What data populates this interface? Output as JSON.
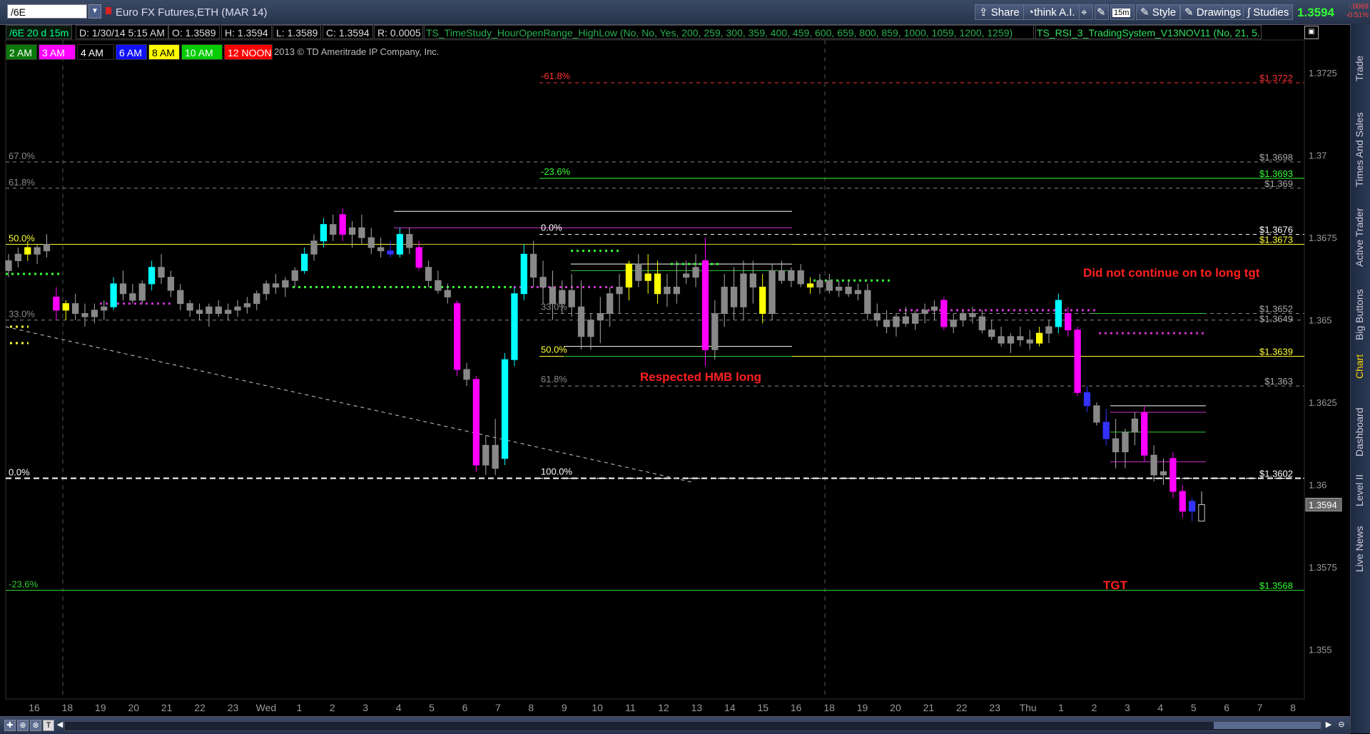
{
  "topbar": {
    "symbol": "/6E",
    "title": "Euro FX Futures,ETH (MAR 14)",
    "share": "Share",
    "think": "think A.I.",
    "interval": "15m",
    "style": "Style",
    "drawings": "Drawings",
    "studies": "Studies",
    "last_price": "1.3594",
    "change_abs": "-.0069",
    "change_pct": "-0.51%"
  },
  "inforow": {
    "period": "/6E 20 d 15m",
    "date": "D: 1/30/14 5:15 AM",
    "open": "O: 1.3589",
    "high": "H: 1.3594",
    "low": "L: 1.3589",
    "close": "C: 1.3594",
    "range": "R: 0.0005",
    "study1": "TS_TimeStudy_HourOpenRange_HighLow (No, No, Yes, 200, 259, 300, 359, 400, 459, 600, 659, 800, 859, 1000, 1059, 1200, 1259)",
    "study2": "TS_RSI_3_TradingSystem_V13NOV11 (No, 21, 5..."
  },
  "timeboxes": [
    {
      "label": "2 AM",
      "bg": "#0a7a0a",
      "fg": "#ffffff"
    },
    {
      "label": "3 AM",
      "bg": "#ff00ff",
      "fg": "#ffffff"
    },
    {
      "label": "4 AM",
      "bg": "#000000",
      "fg": "#ffffff"
    },
    {
      "label": "6 AM",
      "bg": "#1010ff",
      "fg": "#ffffff"
    },
    {
      "label": "8 AM",
      "bg": "#ffff00",
      "fg": "#000000"
    },
    {
      "label": "10 AM",
      "bg": "#00cc00",
      "fg": "#ffffff"
    },
    {
      "label": "12 NOON",
      "bg": "#ff0000",
      "fg": "#ffffff"
    }
  ],
  "copyright": "2013 © TD Ameritrade IP Company, Inc.",
  "sidebar": [
    "Trade",
    "Times And Sales",
    "Active Trader",
    "Big Buttons",
    "Chart",
    "Dashboard",
    "Level II",
    "Live News"
  ],
  "chart_data": {
    "type": "line",
    "ylim": [
      1.3535,
      1.3735
    ],
    "y_ticks": [
      "1.3725",
      "1.37",
      "1.3675",
      "1.365",
      "1.3625",
      "1.36",
      "1.3575",
      "1.355"
    ],
    "x_ticks": [
      "16",
      "18",
      "19",
      "20",
      "21",
      "22",
      "23",
      "Wed",
      "1",
      "2",
      "3",
      "4",
      "5",
      "6",
      "7",
      "8",
      "9",
      "10",
      "11",
      "12",
      "13",
      "14",
      "15",
      "16",
      "18",
      "19",
      "20",
      "21",
      "22",
      "23",
      "Thu",
      "1",
      "2",
      "3",
      "4",
      "5",
      "6",
      "7",
      "8"
    ],
    "last_price_tag": "1.3594",
    "fib_left": [
      {
        "label": "67.0%",
        "price": 1.3698
      },
      {
        "label": "61.8%",
        "price": 1.369
      },
      {
        "label": "50.0%",
        "price": 1.3673
      },
      {
        "label": "33.0%",
        "price": 1.365
      },
      {
        "label": "0.0%",
        "price": 1.3602
      },
      {
        "label": "-23.6%",
        "price": 1.3568
      }
    ],
    "fib_mid": [
      {
        "label": "-61.8%",
        "price": 1.3722
      },
      {
        "label": "-23.6%",
        "price": 1.3693
      },
      {
        "label": "0.0%",
        "price": 1.3676
      },
      {
        "label": "33.0%",
        "price": 1.3652
      },
      {
        "label": "50.0%",
        "price": 1.3639
      },
      {
        "label": "61.8%",
        "price": 1.363
      },
      {
        "label": "100.0%",
        "price": 1.3602
      }
    ],
    "price_labels": [
      {
        "text": "$1.3722",
        "price": 1.3722,
        "color": "#ff3333"
      },
      {
        "text": "$1.3698",
        "price": 1.3698,
        "color": "#aaaaaa"
      },
      {
        "text": "$1.3693",
        "price": 1.3693,
        "color": "#33ff33"
      },
      {
        "text": "$1.369",
        "price": 1.369,
        "color": "#aaaaaa"
      },
      {
        "text": "$1.3676",
        "price": 1.3676,
        "color": "#ffffff"
      },
      {
        "text": "$1.3673",
        "price": 1.3673,
        "color": "#ffff33"
      },
      {
        "text": "$1.3652",
        "price": 1.3652,
        "color": "#aaaaaa"
      },
      {
        "text": "$1.3649",
        "price": 1.3649,
        "color": "#aaaaaa"
      },
      {
        "text": "$1.3639",
        "price": 1.3639,
        "color": "#ffff33"
      },
      {
        "text": "$1.363",
        "price": 1.363,
        "color": "#aaaaaa"
      },
      {
        "text": "$1.3602",
        "price": 1.3602,
        "color": "#ffffff"
      },
      {
        "text": "$1.3568",
        "price": 1.3568,
        "color": "#33ff33"
      }
    ],
    "annotations": [
      {
        "text": "Respected HMB long",
        "color": "#ff2020"
      },
      {
        "text": "Did not continue on to long tgt",
        "color": "#ff2020"
      },
      {
        "text": "TGT",
        "color": "#ff2020"
      }
    ],
    "candles": [
      [
        1.3668,
        1.367,
        1.3663,
        1.3665,
        "#888888"
      ],
      [
        1.367,
        1.3672,
        1.3666,
        1.3668,
        "#888888"
      ],
      [
        1.3672,
        1.3674,
        1.3668,
        1.367,
        "#ffff00"
      ],
      [
        1.367,
        1.3673,
        1.3667,
        1.3672,
        "#888888"
      ],
      [
        1.3673,
        1.3676,
        1.3669,
        1.3671,
        "#888888"
      ],
      [
        1.3657,
        1.366,
        1.365,
        1.3653,
        "#ff00ff"
      ],
      [
        1.3653,
        1.3656,
        1.365,
        1.3655,
        "#ffff00"
      ],
      [
        1.3655,
        1.3658,
        1.365,
        1.3652,
        "#888888"
      ],
      [
        1.3652,
        1.3655,
        1.3648,
        1.3651,
        "#888888"
      ],
      [
        1.3651,
        1.3655,
        1.3649,
        1.3653,
        "#888888"
      ],
      [
        1.3653,
        1.3656,
        1.365,
        1.3654,
        "#888888"
      ],
      [
        1.3654,
        1.3663,
        1.3653,
        1.3661,
        "#00ffff"
      ],
      [
        1.3661,
        1.3665,
        1.3656,
        1.3658,
        "#888888"
      ],
      [
        1.3658,
        1.3661,
        1.3655,
        1.3656,
        "#888888"
      ],
      [
        1.3656,
        1.3662,
        1.3655,
        1.3661,
        "#888888"
      ],
      [
        1.3661,
        1.3668,
        1.3659,
        1.3666,
        "#00ffff"
      ],
      [
        1.3666,
        1.367,
        1.3661,
        1.3663,
        "#888888"
      ],
      [
        1.3663,
        1.3665,
        1.3657,
        1.3659,
        "#888888"
      ],
      [
        1.3659,
        1.3661,
        1.3653,
        1.3655,
        "#888888"
      ],
      [
        1.3655,
        1.3656,
        1.3651,
        1.3653,
        "#888888"
      ],
      [
        1.3653,
        1.3655,
        1.365,
        1.3652,
        "#888888"
      ],
      [
        1.3652,
        1.3655,
        1.3648,
        1.3654,
        "#888888"
      ],
      [
        1.3654,
        1.3656,
        1.3651,
        1.3652,
        "#888888"
      ],
      [
        1.3652,
        1.3655,
        1.365,
        1.3653,
        "#888888"
      ],
      [
        1.3653,
        1.3656,
        1.3651,
        1.3654,
        "#888888"
      ],
      [
        1.3654,
        1.3657,
        1.3652,
        1.3655,
        "#888888"
      ],
      [
        1.3655,
        1.3659,
        1.3653,
        1.3658,
        "#888888"
      ],
      [
        1.3658,
        1.3662,
        1.3656,
        1.3661,
        "#888888"
      ],
      [
        1.3661,
        1.3664,
        1.3658,
        1.366,
        "#888888"
      ],
      [
        1.366,
        1.3663,
        1.3657,
        1.3662,
        "#888888"
      ],
      [
        1.3662,
        1.3666,
        1.366,
        1.3665,
        "#888888"
      ],
      [
        1.3665,
        1.3672,
        1.3664,
        1.367,
        "#00ffff"
      ],
      [
        1.367,
        1.3676,
        1.3668,
        1.3674,
        "#888888"
      ],
      [
        1.3674,
        1.3681,
        1.3672,
        1.3679,
        "#00ffff"
      ],
      [
        1.3679,
        1.3682,
        1.3674,
        1.3676,
        "#888888"
      ],
      [
        1.3682,
        1.3684,
        1.3674,
        1.3676,
        "#ff00ff"
      ],
      [
        1.3676,
        1.368,
        1.3672,
        1.3678,
        "#888888"
      ],
      [
        1.3678,
        1.3682,
        1.3673,
        1.3675,
        "#888888"
      ],
      [
        1.3675,
        1.3678,
        1.367,
        1.3672,
        "#888888"
      ],
      [
        1.3672,
        1.3675,
        1.3669,
        1.3671,
        "#888888"
      ],
      [
        1.3671,
        1.3674,
        1.3669,
        1.367,
        "#3333ff"
      ],
      [
        1.367,
        1.3678,
        1.3669,
        1.3676,
        "#00ffff"
      ],
      [
        1.3676,
        1.3678,
        1.367,
        1.3672,
        "#888888"
      ],
      [
        1.3672,
        1.3674,
        1.3665,
        1.3666,
        "#ff00ff"
      ],
      [
        1.3666,
        1.3668,
        1.366,
        1.3662,
        "#888888"
      ],
      [
        1.3662,
        1.3665,
        1.3658,
        1.3659,
        "#888888"
      ],
      [
        1.3659,
        1.3661,
        1.3655,
        1.3657,
        "#888888"
      ],
      [
        1.3655,
        1.3656,
        1.3633,
        1.3635,
        "#ff00ff"
      ],
      [
        1.3635,
        1.3637,
        1.363,
        1.3632,
        "#888888"
      ],
      [
        1.3632,
        1.3633,
        1.3604,
        1.3606,
        "#ff00ff"
      ],
      [
        1.3606,
        1.3615,
        1.3603,
        1.3612,
        "#888888"
      ],
      [
        1.3612,
        1.362,
        1.3603,
        1.3605,
        "#888888"
      ],
      [
        1.3608,
        1.364,
        1.3606,
        1.3638,
        "#00ffff"
      ],
      [
        1.3638,
        1.366,
        1.3636,
        1.3658,
        "#00ffff"
      ],
      [
        1.3658,
        1.3673,
        1.3656,
        1.367,
        "#00ffff"
      ],
      [
        1.367,
        1.3674,
        1.366,
        1.3663,
        "#888888"
      ],
      [
        1.3663,
        1.3668,
        1.3655,
        1.366,
        "#888888"
      ],
      [
        1.366,
        1.3665,
        1.365,
        1.3655,
        "#888888"
      ],
      [
        1.3655,
        1.3662,
        1.3652,
        1.3659,
        "#888888"
      ],
      [
        1.3659,
        1.3664,
        1.3651,
        1.3654,
        "#888888"
      ],
      [
        1.3654,
        1.3662,
        1.3641,
        1.3645,
        "#888888"
      ],
      [
        1.3645,
        1.3652,
        1.3641,
        1.365,
        "#888888"
      ],
      [
        1.365,
        1.3657,
        1.3643,
        1.3652,
        "#888888"
      ],
      [
        1.3652,
        1.366,
        1.3648,
        1.3658,
        "#888888"
      ],
      [
        1.3658,
        1.3664,
        1.3652,
        1.366,
        "#888888"
      ],
      [
        1.366,
        1.3668,
        1.3656,
        1.3667,
        "#ffff00"
      ],
      [
        1.3667,
        1.367,
        1.366,
        1.3662,
        "#888888"
      ],
      [
        1.3662,
        1.367,
        1.3658,
        1.3664,
        "#ffff00"
      ],
      [
        1.3664,
        1.3668,
        1.3655,
        1.3658,
        "#ffff00"
      ],
      [
        1.3658,
        1.3664,
        1.3654,
        1.366,
        "#888888"
      ],
      [
        1.366,
        1.3668,
        1.3655,
        1.3658,
        "#888888"
      ],
      [
        1.3664,
        1.3668,
        1.3661,
        1.3663,
        "#888888"
      ],
      [
        1.3663,
        1.367,
        1.366,
        1.3666,
        "#888888"
      ],
      [
        1.3668,
        1.3675,
        1.3636,
        1.3641,
        "#ff00ff"
      ],
      [
        1.3641,
        1.3656,
        1.3638,
        1.3652,
        "#888888"
      ],
      [
        1.3652,
        1.3664,
        1.3648,
        1.366,
        "#888888"
      ],
      [
        1.366,
        1.3666,
        1.365,
        1.3654,
        "#888888"
      ],
      [
        1.3654,
        1.3668,
        1.365,
        1.3664,
        "#888888"
      ],
      [
        1.3664,
        1.3668,
        1.3655,
        1.366,
        "#888888"
      ],
      [
        1.366,
        1.3664,
        1.3649,
        1.3652,
        "#ffff00"
      ],
      [
        1.3652,
        1.3667,
        1.365,
        1.3665,
        "#888888"
      ],
      [
        1.3665,
        1.3668,
        1.3661,
        1.3662,
        "#888888"
      ],
      [
        1.3662,
        1.3666,
        1.366,
        1.3665,
        "#888888"
      ],
      [
        1.3665,
        1.3667,
        1.366,
        1.3661,
        "#888888"
      ],
      [
        1.3661,
        1.3663,
        1.3658,
        1.366,
        "#ffff00"
      ],
      [
        1.366,
        1.3664,
        1.3658,
        1.3662,
        "#888888"
      ],
      [
        1.3662,
        1.3664,
        1.3658,
        1.3659,
        "#888888"
      ],
      [
        1.3659,
        1.3662,
        1.3657,
        1.366,
        "#888888"
      ],
      [
        1.366,
        1.3662,
        1.3657,
        1.3658,
        "#888888"
      ],
      [
        1.3658,
        1.3661,
        1.3656,
        1.3659,
        "#888888"
      ],
      [
        1.3659,
        1.3661,
        1.365,
        1.3652,
        "#888888"
      ],
      [
        1.3652,
        1.3655,
        1.3648,
        1.365,
        "#888888"
      ],
      [
        1.365,
        1.3653,
        1.3646,
        1.3648,
        "#888888"
      ],
      [
        1.3648,
        1.3652,
        1.3645,
        1.3651,
        "#888888"
      ],
      [
        1.3651,
        1.3654,
        1.3648,
        1.3649,
        "#888888"
      ],
      [
        1.3649,
        1.3653,
        1.3647,
        1.3652,
        "#888888"
      ],
      [
        1.3652,
        1.3655,
        1.3649,
        1.3653,
        "#888888"
      ],
      [
        1.3653,
        1.3656,
        1.365,
        1.3654,
        "#888888"
      ],
      [
        1.3656,
        1.3657,
        1.3647,
        1.3648,
        "#ff00ff"
      ],
      [
        1.3648,
        1.3652,
        1.3646,
        1.365,
        "#888888"
      ],
      [
        1.365,
        1.3653,
        1.3648,
        1.3652,
        "#888888"
      ],
      [
        1.3652,
        1.3654,
        1.3649,
        1.3651,
        "#888888"
      ],
      [
        1.3651,
        1.3653,
        1.3646,
        1.3647,
        "#888888"
      ],
      [
        1.3647,
        1.365,
        1.3644,
        1.3645,
        "#888888"
      ],
      [
        1.3645,
        1.3648,
        1.3642,
        1.3643,
        "#888888"
      ],
      [
        1.3643,
        1.3646,
        1.364,
        1.3645,
        "#888888"
      ],
      [
        1.3645,
        1.3648,
        1.3642,
        1.3644,
        "#888888"
      ],
      [
        1.3644,
        1.3647,
        1.3641,
        1.3643,
        "#888888"
      ],
      [
        1.3643,
        1.3648,
        1.3642,
        1.3646,
        "#ffff00"
      ],
      [
        1.3646,
        1.365,
        1.3643,
        1.3648,
        "#888888"
      ],
      [
        1.3648,
        1.3658,
        1.3646,
        1.3656,
        "#00ffff"
      ],
      [
        1.3652,
        1.3654,
        1.3645,
        1.3647,
        "#ff00ff"
      ],
      [
        1.3647,
        1.3648,
        1.3627,
        1.3628,
        "#ff00ff"
      ],
      [
        1.3628,
        1.363,
        1.3622,
        1.3624,
        "#3333ff"
      ],
      [
        1.3624,
        1.3625,
        1.3618,
        1.3619,
        "#888888"
      ],
      [
        1.3619,
        1.3623,
        1.3612,
        1.3614,
        "#3333ff"
      ],
      [
        1.3614,
        1.362,
        1.3605,
        1.361,
        "#888888"
      ],
      [
        1.361,
        1.3617,
        1.3605,
        1.3616,
        "#888888"
      ],
      [
        1.3616,
        1.3622,
        1.3612,
        1.362,
        "#888888"
      ],
      [
        1.3622,
        1.3624,
        1.3607,
        1.3609,
        "#ff00ff"
      ],
      [
        1.3609,
        1.3612,
        1.3601,
        1.3603,
        "#888888"
      ],
      [
        1.3603,
        1.3608,
        1.36,
        1.3604,
        "#888888"
      ],
      [
        1.3608,
        1.361,
        1.3596,
        1.3598,
        "#ff00ff"
      ],
      [
        1.3598,
        1.36,
        1.359,
        1.3592,
        "#ff00ff"
      ],
      [
        1.3592,
        1.3596,
        1.3589,
        1.3595,
        "#3333ff"
      ],
      [
        1.3589,
        1.3598,
        1.3589,
        1.3594,
        "#000000"
      ]
    ]
  }
}
